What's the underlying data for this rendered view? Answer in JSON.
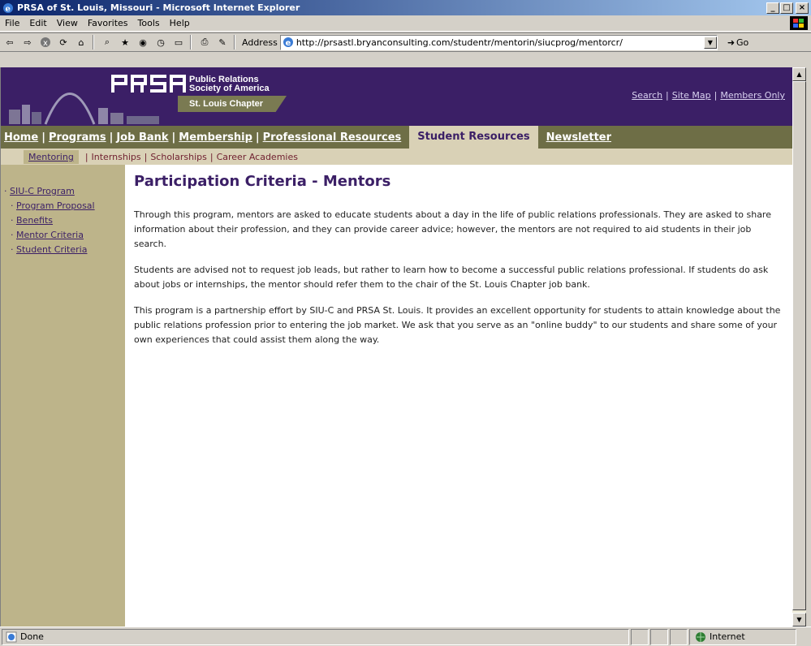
{
  "window": {
    "title": "PRSA of St. Louis, Missouri - Microsoft Internet Explorer"
  },
  "menu": [
    "File",
    "Edit",
    "View",
    "Favorites",
    "Tools",
    "Help"
  ],
  "address": {
    "label": "Address",
    "url": "http://prsastl.bryanconsulting.com/studentr/mentorin/siucprog/mentorcr/",
    "go": "Go"
  },
  "banner": {
    "org_line1": "Public Relations",
    "org_line2": "Society of America",
    "chapter": "St. Louis Chapter",
    "util_links": [
      "Search",
      "Site Map",
      "Members Only"
    ]
  },
  "mainnav": [
    "Home",
    "Programs",
    "Job Bank",
    "Membership",
    "Professional Resources",
    "Student Resources",
    "Newsletter"
  ],
  "subnav": [
    "Mentoring",
    "Internships",
    "Scholarships",
    "Career Academies"
  ],
  "sidebar": [
    {
      "label": "SIU-C Program",
      "level": 0
    },
    {
      "label": "Program Proposal",
      "level": 1
    },
    {
      "label": "Benefits",
      "level": 1
    },
    {
      "label": "Mentor Criteria",
      "level": 1
    },
    {
      "label": "Student Criteria",
      "level": 1
    }
  ],
  "content": {
    "heading": "Participation Criteria - Mentors",
    "paragraphs": [
      "Through this program, mentors are asked to educate students about a day in the life of public relations professionals.  They are asked to share information about their profession, and they can provide career advice; however, the mentors are not required to aid students in their job search.",
      "Students are advised not to request job leads, but rather to learn how to become a successful public relations professional.  If students do ask about jobs or internships, the mentor should refer them to the chair of the St. Louis Chapter job bank.",
      "This program is a partnership effort by SIU-C and PRSA St. Louis. It provides an excellent opportunity for students to attain knowledge about the public relations profession prior to entering the job market.  We ask that you serve as an \"online buddy\" to our students and share some of your own experiences that could assist them along the way."
    ]
  },
  "status": {
    "text": "Done",
    "zone": "Internet"
  },
  "colors": {
    "banner": "#3b1f66",
    "nav": "#6e6e46",
    "subnav": "#d9d1b6",
    "sidebar": "#bdb48a"
  }
}
